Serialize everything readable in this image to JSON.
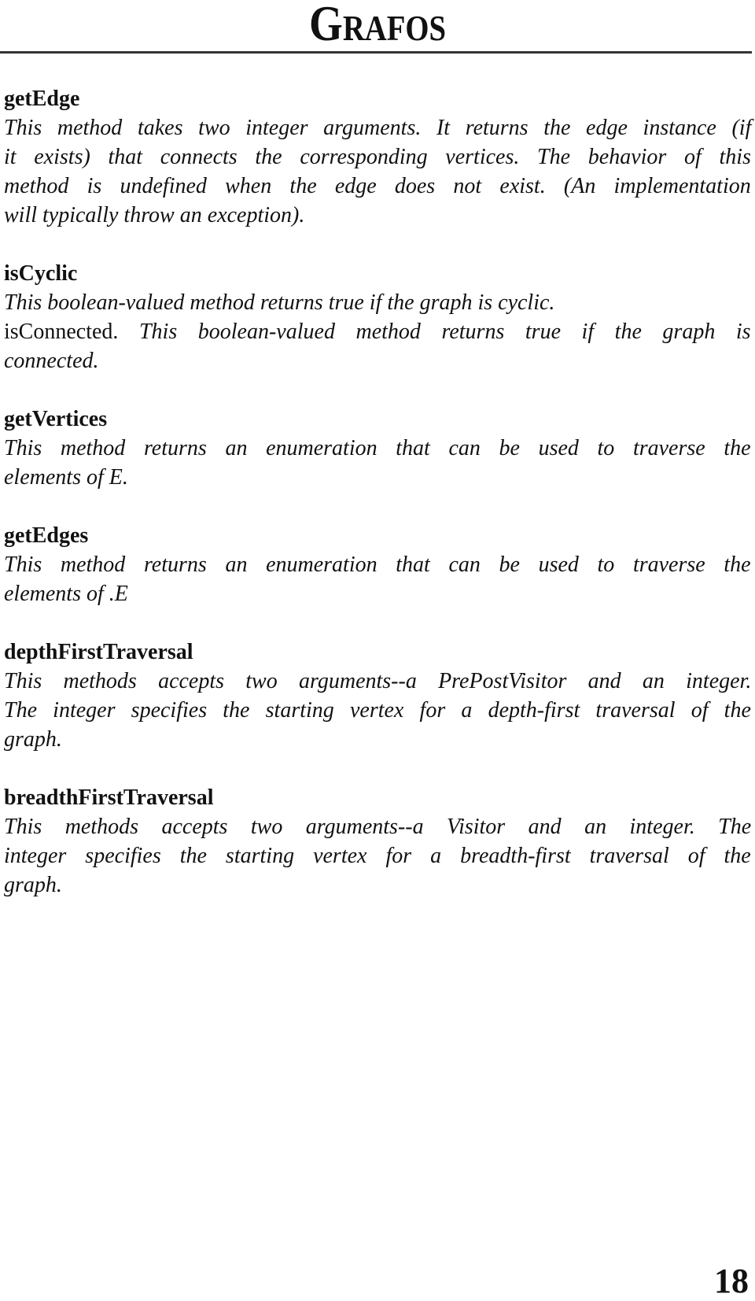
{
  "header": {
    "title": "Grafos"
  },
  "sections": [
    {
      "name": "getEdge",
      "lines": [
        "This method takes two integer arguments. It returns the edge instance (if",
        "it exists) that connects the corresponding vertices. The behavior of this",
        "method is undefined when the edge does not exist. (An implementation",
        "will typically throw an exception)."
      ]
    },
    {
      "name": "isCyclic",
      "lines": [
        "This boolean-valued method returns true if the graph is cyclic."
      ],
      "extra": {
        "lead": "isConnected.",
        "lines": [
          " This boolean-valued method returns true if the graph is",
          "connected."
        ]
      }
    },
    {
      "name": "getVertices",
      "lines": [
        "This method returns an enumeration that can be used to traverse the",
        "elements of E."
      ]
    },
    {
      "name": "getEdges",
      "lines": [
        "This method returns an enumeration that can be used to traverse the",
        "elements of .E"
      ]
    },
    {
      "name": "depthFirstTraversal",
      "lines": [
        "This methods accepts two arguments--a PrePostVisitor and an integer.",
        "The integer specifies the starting vertex for a depth-first traversal of the",
        "graph."
      ]
    },
    {
      "name": "breadthFirstTraversal",
      "lines": [
        "This methods accepts two arguments--a Visitor and an integer. The",
        "integer specifies the starting vertex for a breadth-first traversal of the",
        "graph."
      ]
    }
  ],
  "footer": {
    "page_number": "18"
  }
}
